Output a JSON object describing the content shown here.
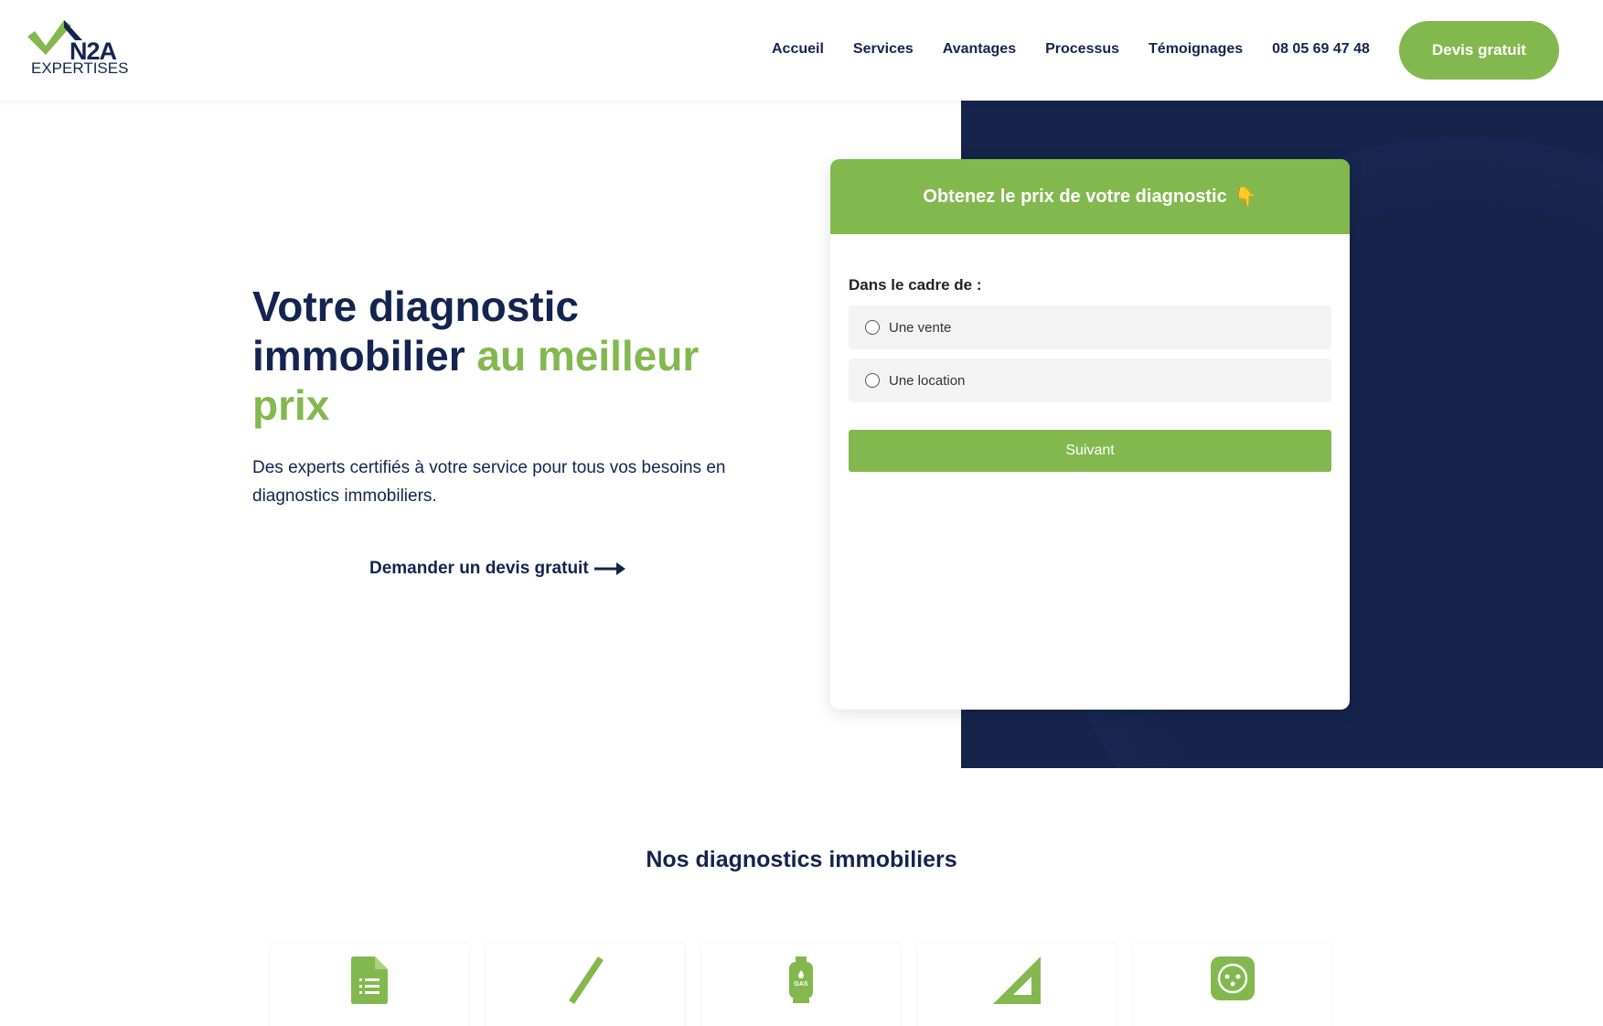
{
  "logo": {
    "brand": "N2A",
    "sub": "EXPERTISES"
  },
  "nav": {
    "items": [
      "Accueil",
      "Services",
      "Avantages",
      "Processus",
      "Témoignages"
    ],
    "phone": "08 05 69 47 48",
    "cta": "Devis gratuit"
  },
  "hero": {
    "title_part1": "Votre diagnostic immobilier",
    "title_green": "au meilleur prix",
    "subtitle": "Des experts certifiés à votre service pour tous vos besoins en diagnostics immobiliers.",
    "link": "Demander un devis gratuit"
  },
  "form": {
    "header": "Obtenez le prix de votre diagnostic",
    "emoji": "👇",
    "label": "Dans le cadre de :",
    "options": [
      "Une vente",
      "Une location"
    ],
    "submit": "Suivant"
  },
  "services": {
    "title": "Nos diagnostics immobiliers",
    "icons": [
      "document-list-icon",
      "pencil-icon",
      "gas-bottle-icon",
      "set-square-icon",
      "electric-socket-icon"
    ],
    "gas_text": "GAS"
  },
  "colors": {
    "green": "#83b84e",
    "navy": "#142450",
    "dark_panel": "#16234b"
  }
}
